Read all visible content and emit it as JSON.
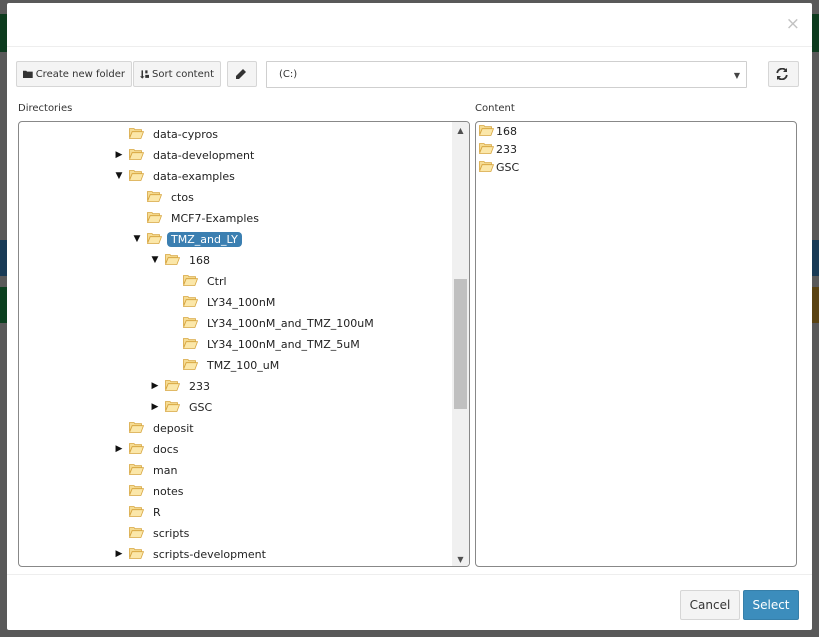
{
  "dialog": {
    "close_label": "×"
  },
  "toolbar": {
    "create_folder_label": "Create new folder",
    "sort_label": "Sort content",
    "drive_value": "(C:)"
  },
  "labels": {
    "directories": "Directories",
    "content": "Content"
  },
  "tree": [
    {
      "label": "data-cypros",
      "depth": 0,
      "toggle": "none",
      "selected": false
    },
    {
      "label": "data-development",
      "depth": 0,
      "toggle": "collapsed",
      "selected": false
    },
    {
      "label": "data-examples",
      "depth": 0,
      "toggle": "expanded",
      "selected": false
    },
    {
      "label": "ctos",
      "depth": 1,
      "toggle": "none",
      "selected": false
    },
    {
      "label": "MCF7-Examples",
      "depth": 1,
      "toggle": "none",
      "selected": false
    },
    {
      "label": "TMZ_and_LY",
      "depth": 1,
      "toggle": "expanded",
      "selected": true
    },
    {
      "label": "168",
      "depth": 2,
      "toggle": "expanded",
      "selected": false
    },
    {
      "label": "Ctrl",
      "depth": 3,
      "toggle": "none",
      "selected": false
    },
    {
      "label": "LY34_100nM",
      "depth": 3,
      "toggle": "none",
      "selected": false
    },
    {
      "label": "LY34_100nM_and_TMZ_100uM",
      "depth": 3,
      "toggle": "none",
      "selected": false
    },
    {
      "label": "LY34_100nM_and_TMZ_5uM",
      "depth": 3,
      "toggle": "none",
      "selected": false
    },
    {
      "label": "TMZ_100_uM",
      "depth": 3,
      "toggle": "none",
      "selected": false
    },
    {
      "label": "233",
      "depth": 2,
      "toggle": "collapsed",
      "selected": false
    },
    {
      "label": "GSC",
      "depth": 2,
      "toggle": "collapsed",
      "selected": false
    },
    {
      "label": "deposit",
      "depth": 0,
      "toggle": "none",
      "selected": false
    },
    {
      "label": "docs",
      "depth": 0,
      "toggle": "collapsed",
      "selected": false
    },
    {
      "label": "man",
      "depth": 0,
      "toggle": "none",
      "selected": false
    },
    {
      "label": "notes",
      "depth": 0,
      "toggle": "none",
      "selected": false
    },
    {
      "label": "R",
      "depth": 0,
      "toggle": "none",
      "selected": false
    },
    {
      "label": "scripts",
      "depth": 0,
      "toggle": "none",
      "selected": false
    },
    {
      "label": "scripts-development",
      "depth": 0,
      "toggle": "collapsed",
      "selected": false
    }
  ],
  "content": [
    "168",
    "233",
    "GSC"
  ],
  "footer": {
    "cancel_label": "Cancel",
    "select_label": "Select"
  },
  "colors": {
    "accent": "#3c8dbc",
    "selected_node": "#3b7fb1",
    "folder": "#f0c040"
  }
}
